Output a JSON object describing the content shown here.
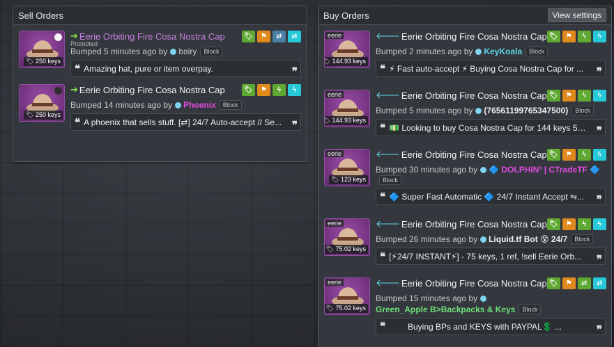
{
  "sell": {
    "header": "Sell Orders",
    "listings": [
      {
        "title": "Eerie Orbiting Fire Cosa Nostra Cap",
        "promoted": "Promoted",
        "price": "250 keys",
        "bumped": "Bumped 5 minutes ago by",
        "user": "bairy",
        "user_color": "#c9c9c9",
        "block": "Block",
        "comment": "Amazing hat, pure or item overpay."
      },
      {
        "title": "Eerie Orbiting Fire Cosa Nostra Cap",
        "price": "250 keys",
        "bumped": "Bumped 14 minutes ago by",
        "user": "Phoenix",
        "user_color": "#e04ae0",
        "block": "Block",
        "comment": "A phoenix that sells stuff. [⇄] 24/7 Auto-accept // Se..."
      }
    ]
  },
  "buy": {
    "header": "Buy Orders",
    "view_settings": "View settings",
    "listings": [
      {
        "quality": "eerie",
        "title": "Eerie Orbiting Fire Cosa Nostra Cap",
        "price": "144.93 keys",
        "bumped": "Bumped 2 minutes ago by",
        "user": "KeyKoala",
        "user_color": "#5ed7e8",
        "block": "Block",
        "comment": "⚡ Fast auto-accept ⚡ Buying Cosa Nostra Cap for ..."
      },
      {
        "quality": "eerie",
        "title": "Eerie Orbiting Fire Cosa Nostra Cap",
        "price": "144.93 keys",
        "bumped": "Bumped 5 minutes ago by",
        "user": "(76561199765347500)",
        "user_color": "#f0f0f0",
        "block": "Block",
        "comment": "💵 Looking to buy Cosa Nostra Cap for 144 keys 52...."
      },
      {
        "quality": "eerie",
        "title": "Eerie Orbiting Fire Cosa Nostra Cap",
        "price": "123 keys",
        "bumped": "Bumped 30 minutes ago by",
        "user": "🔷 DOLPHIN³ | CTradeTF 🔷",
        "user_color": "#e04ae0",
        "block": "Block",
        "comment": "🔷 Super Fast Automatic 🔷 24/7 Instant Accept ⇋..."
      },
      {
        "quality": "eerie",
        "title": "Eerie Orbiting Fire Cosa Nostra Cap",
        "price": "75.02 keys",
        "bumped": "Bumped 26 minutes ago by",
        "user": "Liquid.tf Bot 😵 24/7",
        "user_color": "#f0f0f0",
        "block": "Block",
        "comment": "[⚡24/7 INSTANT⚡] - 75 keys, 1 ref, !sell Eerie Orb..."
      },
      {
        "quality": "eerie",
        "title": "Eerie Orbiting Fire Cosa Nostra Cap",
        "price": "75.02 keys",
        "bumped": "Bumped 15 minutes ago by",
        "user": "Green_Apple B>Backpacks & Keys",
        "user_color": "#6fe07a",
        "block": "Block",
        "comment": "Buying BPs and KEYS with PAYPAL💲  ..."
      }
    ]
  }
}
